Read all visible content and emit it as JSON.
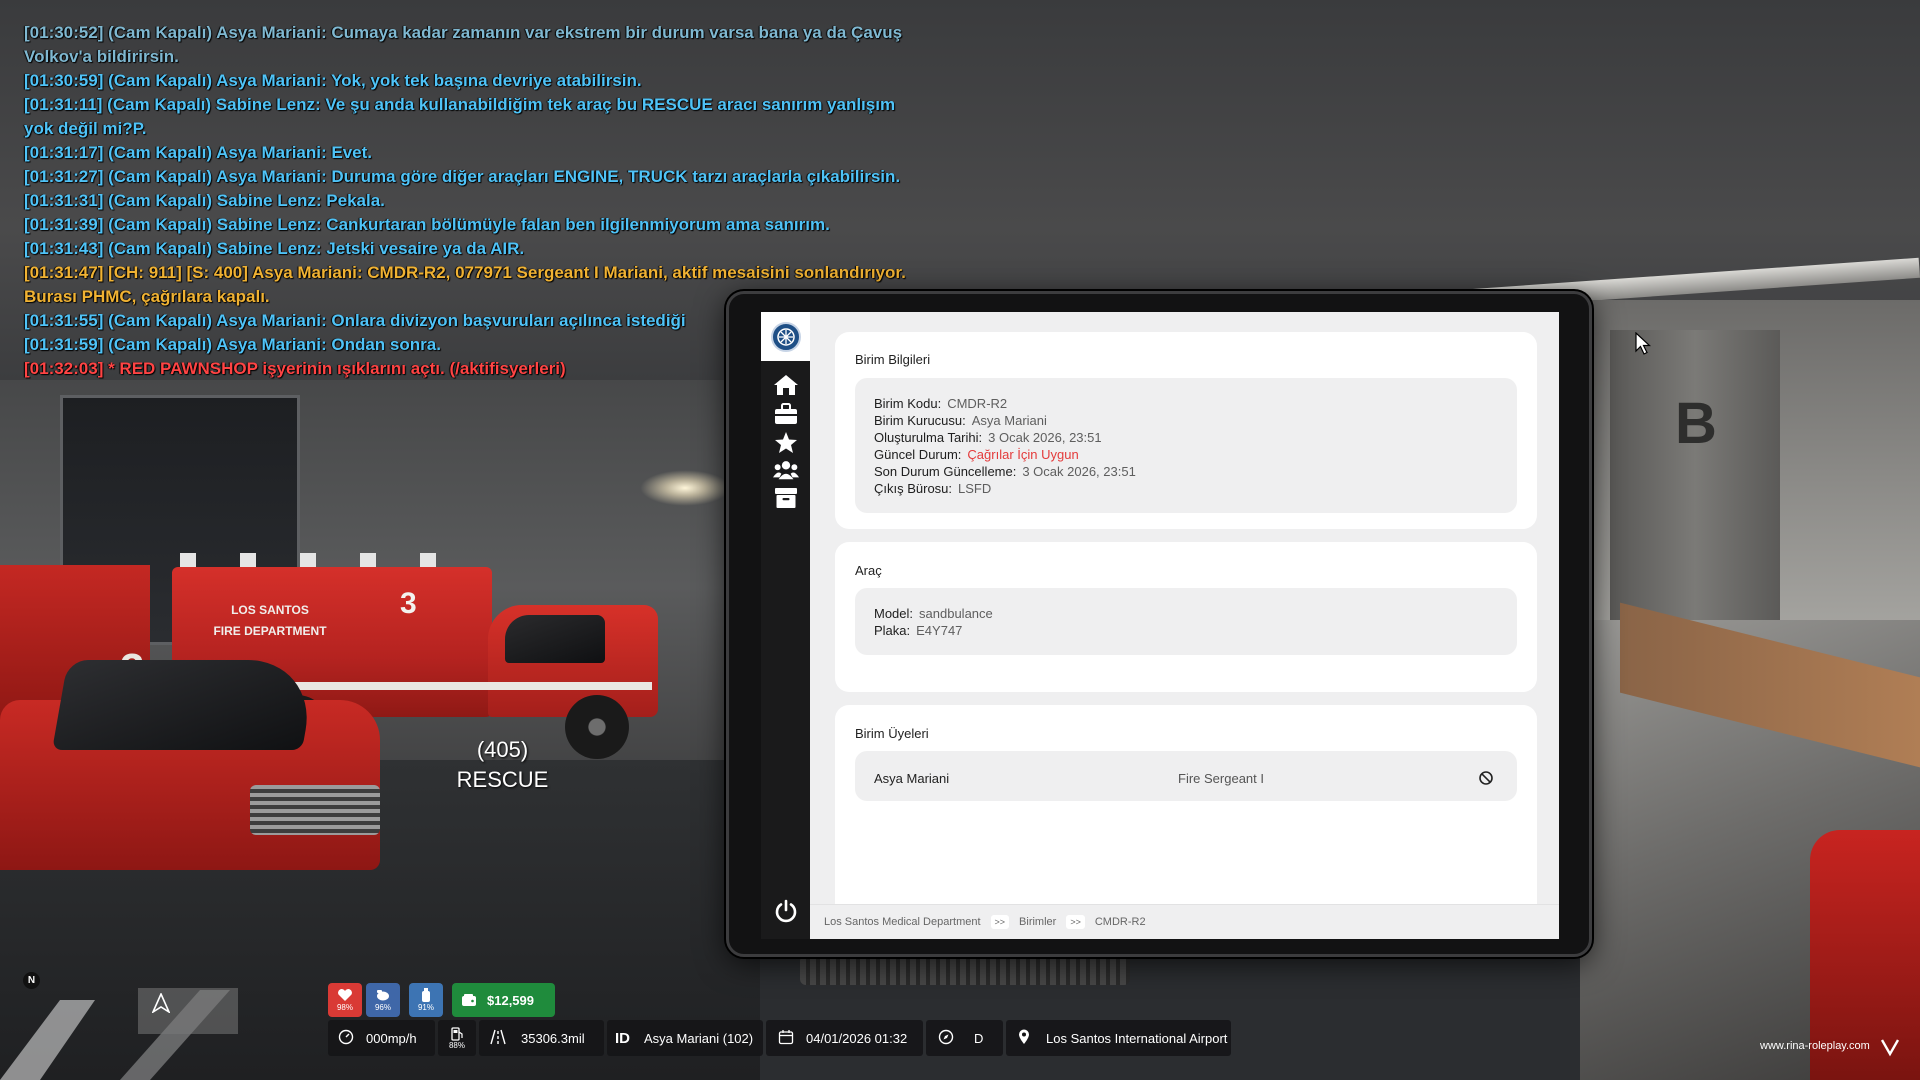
{
  "chat": [
    {
      "text": "[01:30:52] (Cam Kapalı) Asya Mariani: Cumaya kadar zamanın var ekstrem bir durum varsa bana ya da Çavuş",
      "style": "cam dim"
    },
    {
      "text": "Volkov'a bildirirsin.",
      "style": "cam dim"
    },
    {
      "text": "[01:30:59] (Cam Kapalı) Asya Mariani: Yok, yok tek başına devriye atabilirsin.",
      "style": "cam"
    },
    {
      "text": "[01:31:11] (Cam Kapalı) Sabine Lenz: Ve şu anda kullanabildiğim tek araç bu RESCUE aracı sanırım yanlışım",
      "style": "cam"
    },
    {
      "text": "yok değil mi?P.",
      "style": "cam"
    },
    {
      "text": "[01:31:17] (Cam Kapalı) Asya Mariani: Evet.",
      "style": "cam"
    },
    {
      "text": "[01:31:27] (Cam Kapalı) Asya Mariani: Duruma göre diğer araçları ENGINE, TRUCK tarzı araçlarla çıkabilirsin.",
      "style": "cam"
    },
    {
      "text": "[01:31:31] (Cam Kapalı) Sabine Lenz: Pekala.",
      "style": "cam"
    },
    {
      "text": "[01:31:39] (Cam Kapalı) Sabine Lenz: Cankurtaran bölümüyle falan ben ilgilenmiyorum ama sanırım.",
      "style": "cam"
    },
    {
      "text": "[01:31:43] (Cam Kapalı) Sabine Lenz: Jetski vesaire ya da AIR.",
      "style": "cam"
    },
    {
      "text": "[01:31:47] [CH: 911] [S: 400] Asya Mariani: CMDR-R2, 077971 Sergeant I Mariani, aktif mesaisini sonlandırıyor.",
      "style": "radio"
    },
    {
      "text": "Burası PHMC, çağrılara kapalı.",
      "style": "radio"
    },
    {
      "text": "[01:31:55] (Cam Kapalı) Asya Mariani: Onlara divizyon başvuruları açılınca istediği",
      "style": "cam"
    },
    {
      "text": "[01:31:59] (Cam Kapalı) Asya Mariani: Ondan sonra.",
      "style": "cam"
    },
    {
      "text": "[01:32:03] * RED PAWNSHOP işyerinin ışıklarını açtı. (/aktifisyerleri)",
      "style": "action"
    }
  ],
  "scene": {
    "vehicle_label_id": "(405)",
    "vehicle_label_name": "RESCUE",
    "ambulance_text": "LOS SANTOS\nFIRE DEPARTMENT",
    "ambulance_number": "3",
    "side_number": "3",
    "pillar_letter": "B"
  },
  "tablet": {
    "sidebar_icons": [
      "department-logo-icon",
      "home-icon",
      "briefcase-icon",
      "star-icon",
      "users-icon",
      "archive-icon",
      "power-icon"
    ],
    "unit_info": {
      "title": "Birim Bilgileri",
      "code_label": "Birim Kodu:",
      "code_value": "CMDR-R2",
      "founder_label": "Birim Kurucusu:",
      "founder_value": "Asya Mariani",
      "created_label": "Oluşturulma Tarihi:",
      "created_value": "3 Ocak 2026, 23:51",
      "status_label": "Güncel Durum:",
      "status_value": "Çağrılar İçin Uygun",
      "last_update_label": "Son Durum Güncelleme:",
      "last_update_value": "3 Ocak 2026, 23:51",
      "bureau_label": "Çıkış Bürosu:",
      "bureau_value": "LSFD"
    },
    "vehicle": {
      "title": "Araç",
      "model_label": "Model:",
      "model_value": "sandbulance",
      "plate_label": "Plaka:",
      "plate_value": "E4Y747"
    },
    "members": {
      "title": "Birim Üyeleri",
      "list": [
        {
          "name": "Asya Mariani",
          "rank": "Fire Sergeant I"
        }
      ]
    },
    "breadcrumb": [
      "Los Santos Medical Department",
      "Birimler",
      "CMDR-R2"
    ],
    "breadcrumb_sep": ">>"
  },
  "hud": {
    "health": "98%",
    "hunger": "96%",
    "thirst": "91%",
    "money": "$12,599",
    "speed": "000mp/h",
    "fuel": "88%",
    "odometer": "35306.3mil",
    "id_label": "ID",
    "player": "Asya Mariani (102)",
    "datetime": "04/01/2026 01:32",
    "gear": "D",
    "location": "Los Santos International Airport",
    "compass": "N",
    "watermark": "www.rina-roleplay.com"
  },
  "colors": {
    "chat_cam": "#4fc3f7",
    "chat_radio": "#f0b233",
    "chat_action": "#ff4444",
    "status_red": "#e43b3b",
    "money_green": "#1f8b3c",
    "health_red": "#d93a35",
    "hunger_blue": "#3f67a8",
    "thirst_blue": "#3d74b3"
  }
}
